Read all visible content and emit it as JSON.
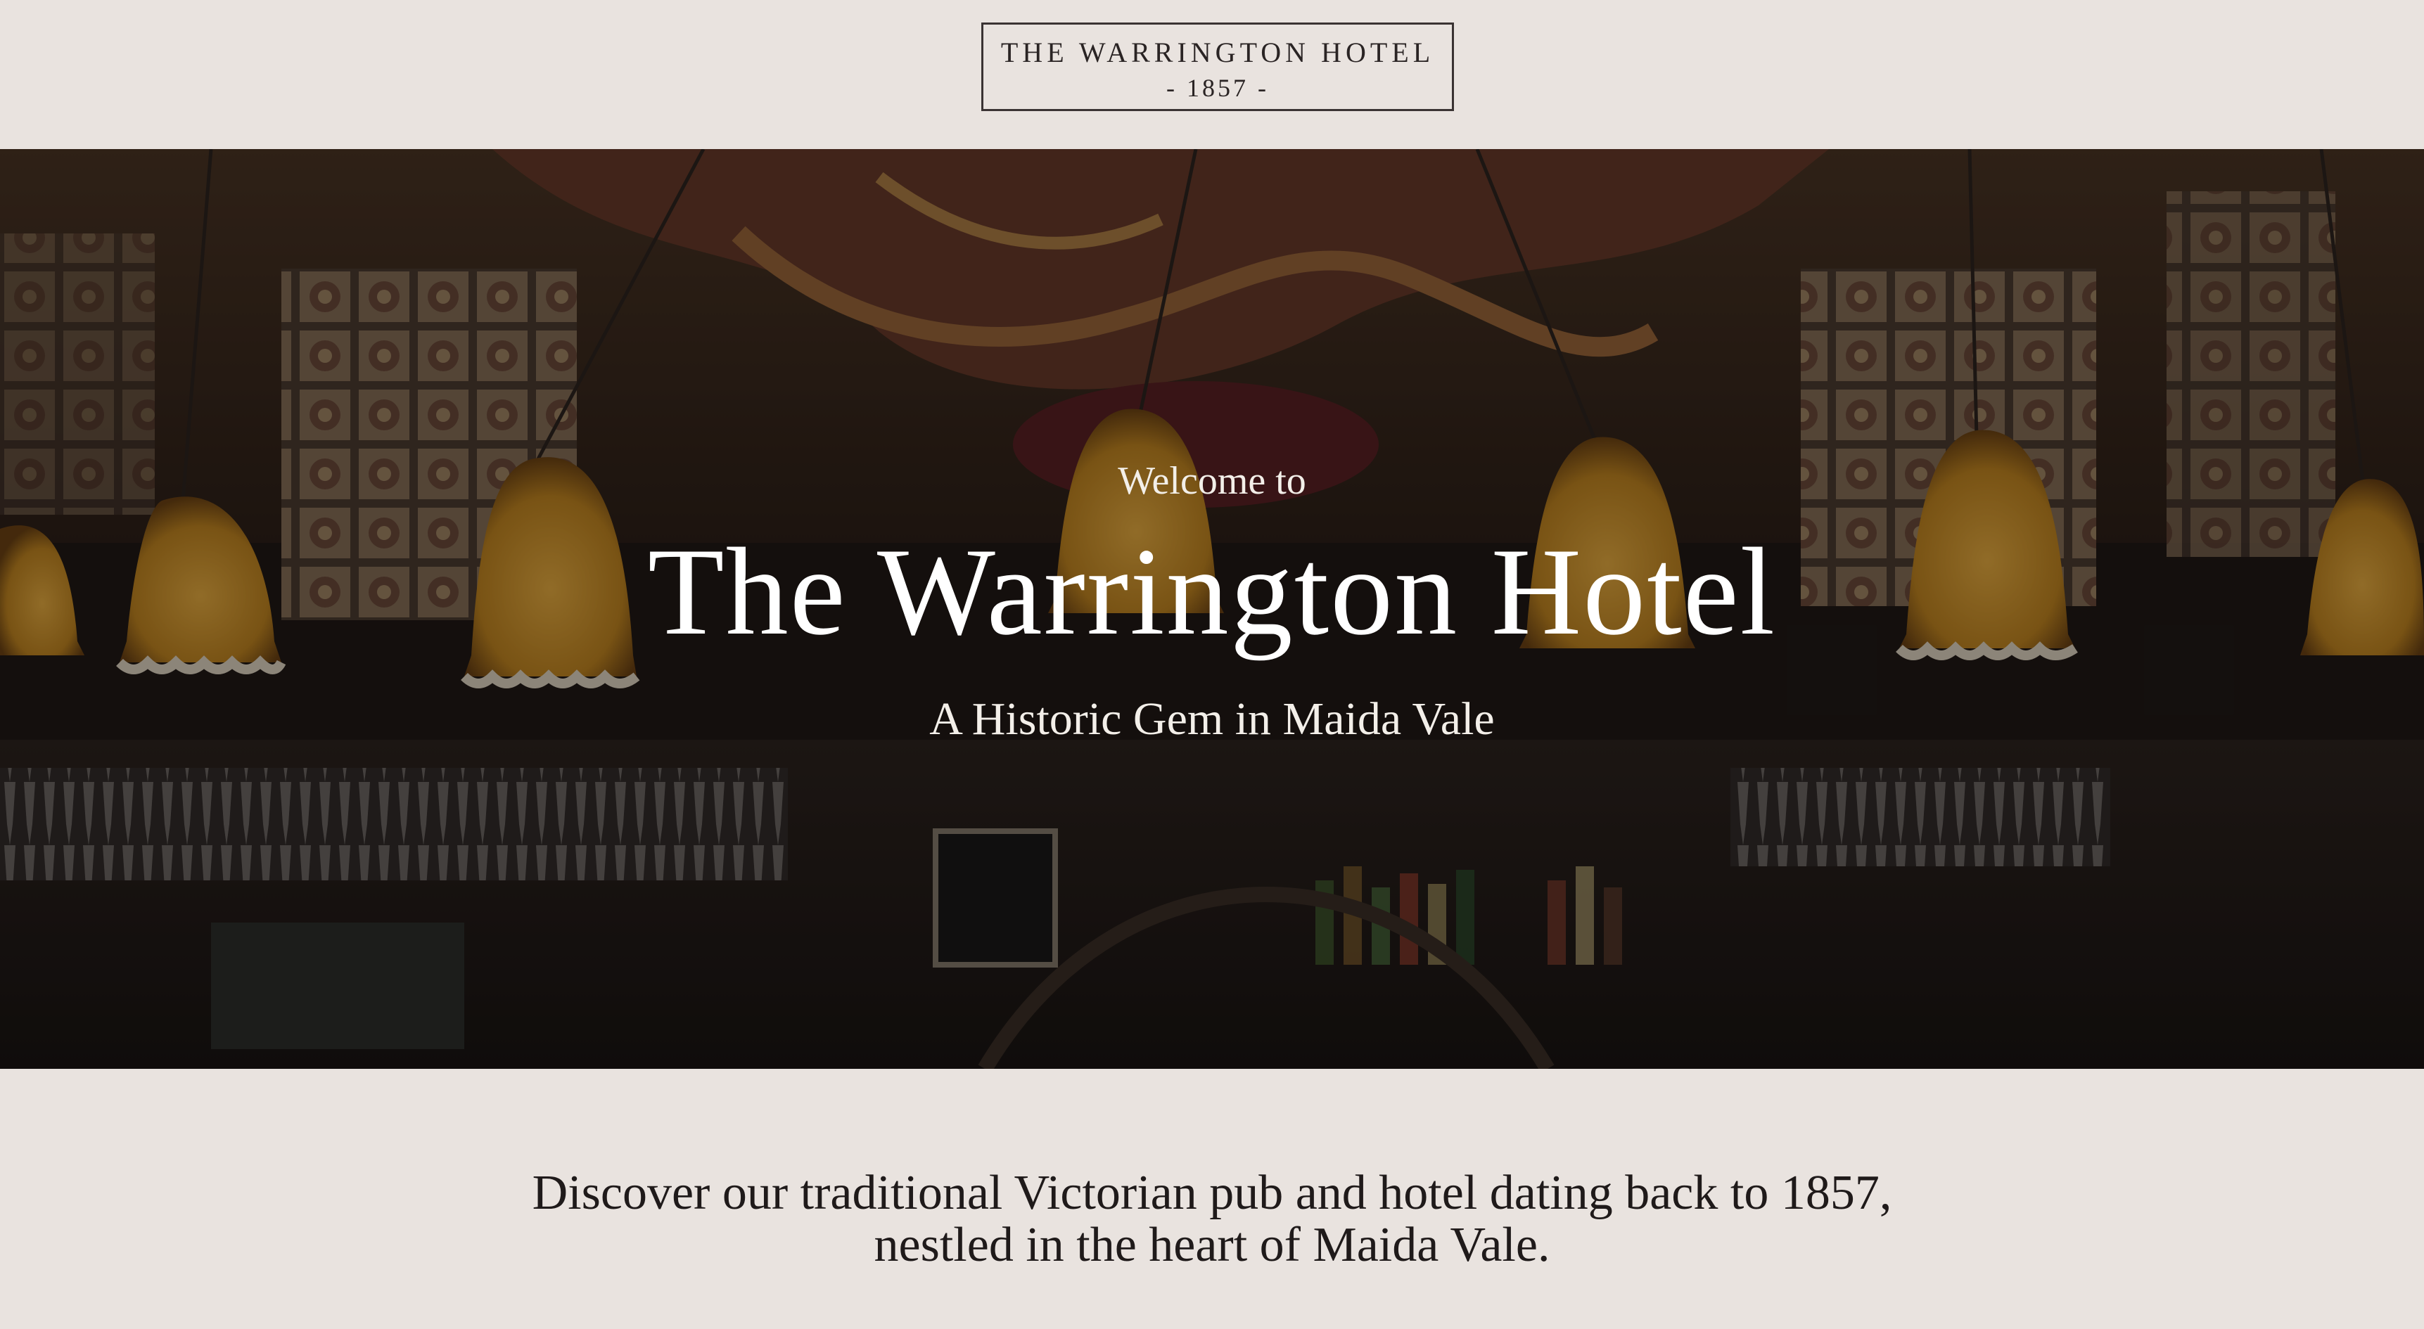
{
  "header": {
    "logo_name": "THE WARRINGTON HOTEL",
    "logo_year": "- 1857 -"
  },
  "hero": {
    "welcome": "Welcome to",
    "title": "The Warrington Hotel",
    "subtitle": "A Historic Gem in Maida Vale"
  },
  "intro": {
    "text": "Discover our traditional Victorian pub and hotel dating back to 1857, nestled in the heart of Maida Vale."
  },
  "colors": {
    "page_background": "#e9e3df",
    "text_dark": "#1f1a1a",
    "hero_text": "#ffffff",
    "lamp_amber": "#c98a1e"
  }
}
